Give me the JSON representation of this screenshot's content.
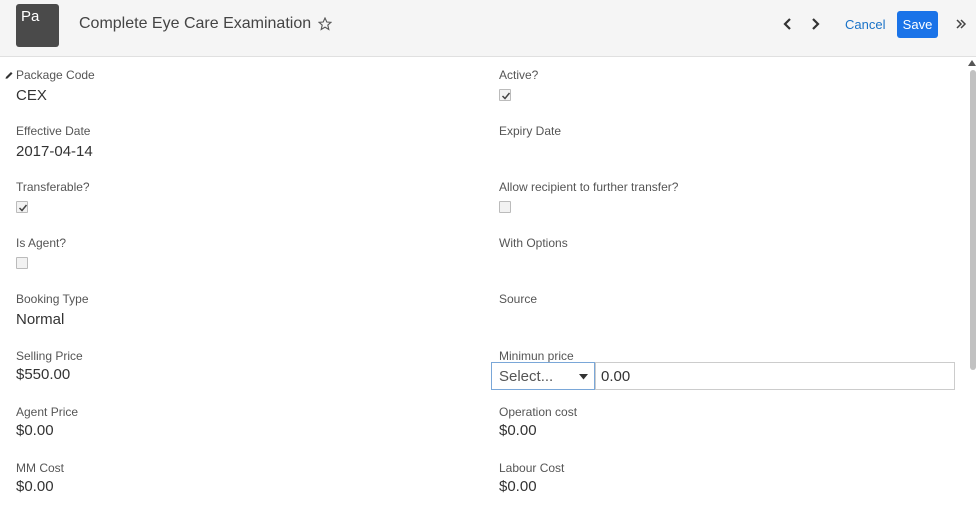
{
  "header": {
    "avatar_text": "Pa",
    "title": "Complete Eye Care Examination",
    "cancel_label": "Cancel",
    "save_label": "Save",
    "accent_color": "#1a73e8"
  },
  "form": {
    "package_code": {
      "label": "Package Code",
      "value": "CEX"
    },
    "active": {
      "label": "Active?",
      "checked": true
    },
    "effective_date": {
      "label": "Effective Date",
      "value": "2017-04-14"
    },
    "expiry_date": {
      "label": "Expiry Date",
      "value": ""
    },
    "transferable": {
      "label": "Transferable?",
      "checked": true
    },
    "allow_further_transfer": {
      "label": "Allow recipient to further transfer?",
      "checked": false
    },
    "is_agent": {
      "label": "Is Agent?",
      "checked": false
    },
    "with_options": {
      "label": "With Options",
      "value": ""
    },
    "booking_type": {
      "label": "Booking Type",
      "value": "Normal"
    },
    "source": {
      "label": "Source",
      "value": ""
    },
    "selling_price": {
      "label": "Selling Price",
      "value": "$550.00"
    },
    "minimum_price": {
      "label": "Minimun price",
      "currency_placeholder": "Select...",
      "value": "0.00"
    },
    "agent_price": {
      "label": "Agent Price",
      "value": "$0.00"
    },
    "operation_cost": {
      "label": "Operation cost",
      "value": "$0.00"
    },
    "mm_cost": {
      "label": "MM Cost",
      "value": "$0.00"
    },
    "labour_cost": {
      "label": "Labour Cost",
      "value": "$0.00"
    }
  }
}
